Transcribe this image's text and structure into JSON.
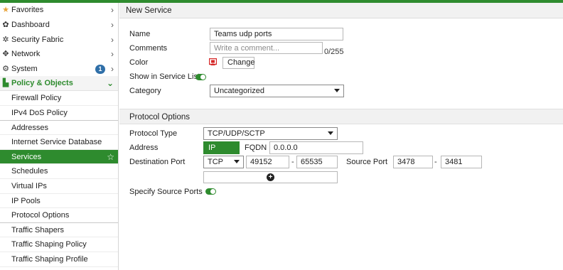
{
  "sidebar": {
    "items": [
      {
        "label": "Favorites",
        "icon": "star-icon",
        "glyph": "★",
        "chevron": "›"
      },
      {
        "label": "Dashboard",
        "icon": "dashboard-icon",
        "glyph": "✿",
        "chevron": "›"
      },
      {
        "label": "Security Fabric",
        "icon": "security-fabric-icon",
        "glyph": "✲",
        "chevron": "›"
      },
      {
        "label": "Network",
        "icon": "network-icon",
        "glyph": "✥",
        "chevron": "›"
      },
      {
        "label": "System",
        "icon": "gear-icon",
        "glyph": "⚙",
        "chevron": "›",
        "badge": "1"
      },
      {
        "label": "Policy & Objects",
        "icon": "policy-icon",
        "glyph": "▙",
        "chevron": "⌄"
      }
    ],
    "sub_items": [
      "Firewall Policy",
      "IPv4 DoS Policy",
      "Addresses",
      "Internet Service Database",
      "Services",
      "Schedules",
      "Virtual IPs",
      "IP Pools",
      "Protocol Options",
      "Traffic Shapers",
      "Traffic Shaping Policy",
      "Traffic Shaping Profile"
    ],
    "active_star": "☆"
  },
  "header": {
    "title": "New Service"
  },
  "form": {
    "name_label": "Name",
    "name_value": "Teams udp ports",
    "comments_label": "Comments",
    "comments_placeholder": "Write a comment...",
    "comments_counter": "0/255",
    "color_label": "Color",
    "change_button": "Change",
    "show_in_list_label": "Show in Service List",
    "category_label": "Category",
    "category_value": "Uncategorized"
  },
  "protocol": {
    "section_title": "Protocol Options",
    "type_label": "Protocol Type",
    "type_value": "TCP/UDP/SCTP",
    "address_label": "Address",
    "ip_range_tab": "IP Range",
    "fqdn_tab": "FQDN",
    "address_value": "0.0.0.0",
    "dest_port_label": "Destination Port",
    "dest_protocol": "TCP",
    "dest_low": "49152",
    "dest_high": "65535",
    "range_separator": "-",
    "source_port_label": "Source Port",
    "src_low": "3478",
    "src_high": "3481",
    "add_glyph": "+",
    "specify_source_label": "Specify Source Ports"
  },
  "colors": {
    "accent": "#2e8b2e",
    "badge": "#2f6fa8",
    "color_swatch": "#d62828"
  }
}
